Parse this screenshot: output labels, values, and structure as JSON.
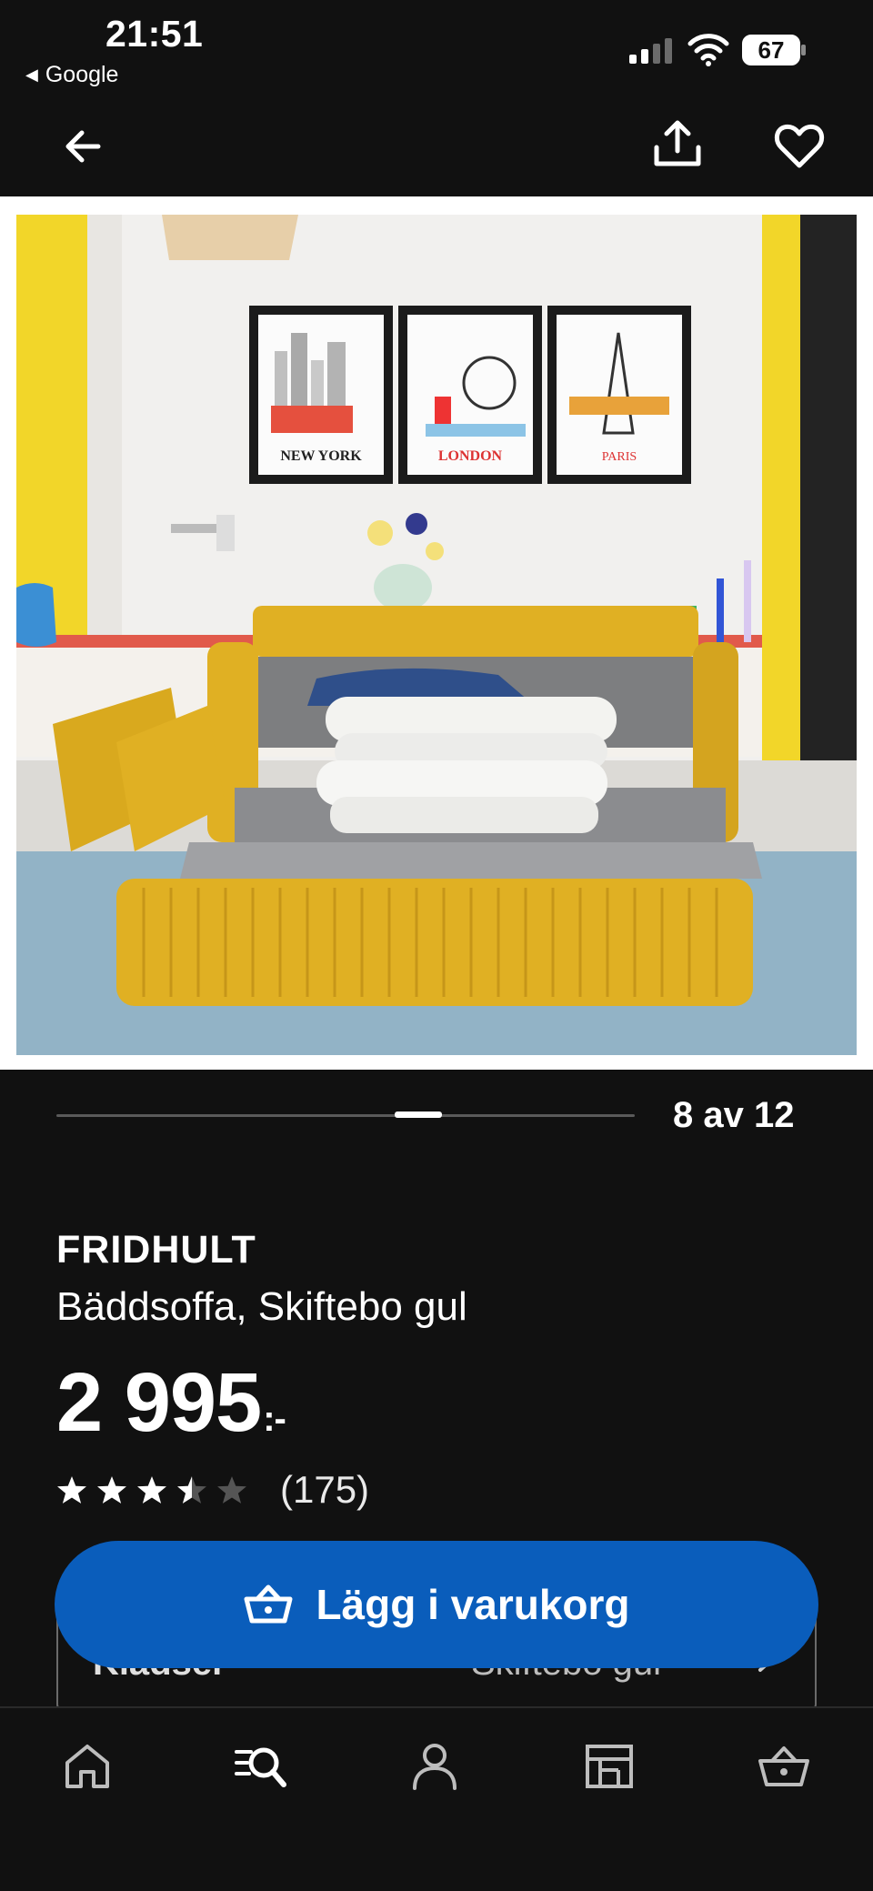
{
  "status_bar": {
    "time": "21:51",
    "back_app": "Google",
    "battery": "67"
  },
  "carousel": {
    "counter": "8 av 12",
    "current": 8,
    "total": 12
  },
  "product": {
    "name": "FRIDHULT",
    "description": "Bäddsoffa, Skiftebo gul",
    "price": "2 995",
    "price_suffix": ":-",
    "rating": 3.5,
    "rating_max": 5,
    "review_count": "(175)"
  },
  "options": {
    "label": "Klädsel",
    "value": "Skiftebo gul"
  },
  "actions": {
    "add_to_cart": "Lägg i varukorg"
  },
  "image_text": {
    "frame1": "NEW YORK",
    "frame2": "LONDON",
    "frame3": "PARIS"
  },
  "colors": {
    "background": "#111111",
    "primary_button": "#0a5dbb",
    "sofa_yellow": "#e0b023"
  },
  "icons": {
    "back": "arrow-left-icon",
    "share": "share-icon",
    "favorite": "heart-icon",
    "cart": "basket-icon",
    "tabs": [
      "home-icon",
      "search-list-icon",
      "person-icon",
      "store-icon",
      "basket-icon"
    ]
  }
}
